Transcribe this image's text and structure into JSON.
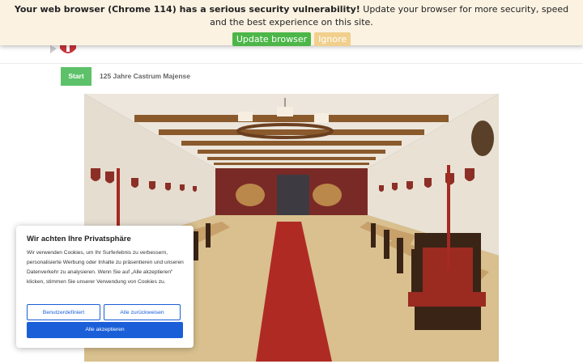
{
  "banner": {
    "strong_text": "Your web browser (Chrome 114) has a serious security vulnerability!",
    "rest_text": " Update your browser for more security, speed and the best experience on this site.",
    "update_label": "Update browser",
    "ignore_label": "Ignore"
  },
  "breadcrumb": {
    "home_label": "Start",
    "current_label": "125 Jahre Castrum Majense"
  },
  "cookie": {
    "title": "Wir achten Ihre Privatsphäre",
    "body": "Wir verwenden Cookies, um Ihr Surferlebnis zu verbessern, personalisierte Werbung oder Inhalte zu präsentieren und unseren Datenverkehr zu analysieren. Wenn Sie auf „Alle akzeptieren“ klicken, stimmen Sie unserer Verwendung von Cookies zu.",
    "customize_label": "Benutzerdefiniert",
    "reject_label": "Alle zurückweisen",
    "accept_label": "Alle akzeptieren"
  },
  "colors": {
    "banner_bg": "#fbf2e2",
    "update_button": "#4cb648",
    "ignore_button": "#f1cf8c",
    "breadcrumb_start": "#5cc168",
    "cookie_accent": "#1a5fd8"
  },
  "icons": {
    "logo": "coat-of-arms-logo"
  }
}
